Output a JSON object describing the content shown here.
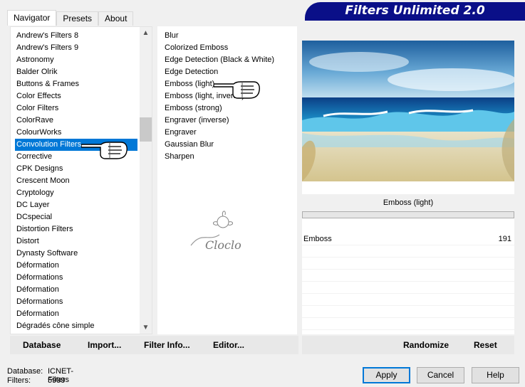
{
  "tabs": [
    {
      "label": "Navigator",
      "active": true
    },
    {
      "label": "Presets",
      "active": false
    },
    {
      "label": "About",
      "active": false
    }
  ],
  "banner": {
    "title": "Filters Unlimited 2.0"
  },
  "categories": {
    "items": [
      "Andrew's Filters 8",
      "Andrew's Filters 9",
      "Astronomy",
      "Balder Olrik",
      "Buttons & Frames",
      "Color Effects",
      "Color Filters",
      "ColorRave",
      "ColourWorks",
      "Convolution Filters",
      "Corrective",
      "CPK Designs",
      "Crescent Moon",
      "Cryptology",
      "DC Layer",
      "DCspecial",
      "Distortion Filters",
      "Distort",
      "Dynasty Software",
      "Déformation",
      "Déformations",
      "Déformation",
      "Déformations",
      "Déformation",
      "Dégradés cône simple"
    ],
    "selected_index": 9
  },
  "filters": {
    "items": [
      "Blur",
      "Colorized Emboss",
      "Edge Detection (Black & White)",
      "Edge Detection",
      "Emboss (light)",
      "Emboss (light, inverse)",
      "Emboss (strong)",
      "Engraver (inverse)",
      "Engraver",
      "Gaussian Blur",
      "Sharpen"
    ],
    "selected_index": 4
  },
  "watermark_text": "Cloclo",
  "current_filter": {
    "name": "Emboss (light)"
  },
  "parameters": [
    {
      "label": "Emboss",
      "value": "191"
    }
  ],
  "bottom_left": {
    "database": "Database",
    "import": "Import...",
    "filter_info": "Filter Info...",
    "editor": "Editor..."
  },
  "bottom_right": {
    "randomize": "Randomize",
    "reset": "Reset"
  },
  "status": {
    "database_label": "Database:",
    "database_value": "ICNET-Filters",
    "filters_label": "Filters:",
    "filters_value": "5999"
  },
  "buttons": {
    "apply": "Apply",
    "cancel": "Cancel",
    "help": "Help"
  },
  "colors": {
    "banner": "#0a0f88",
    "selection": "#0078d7"
  }
}
